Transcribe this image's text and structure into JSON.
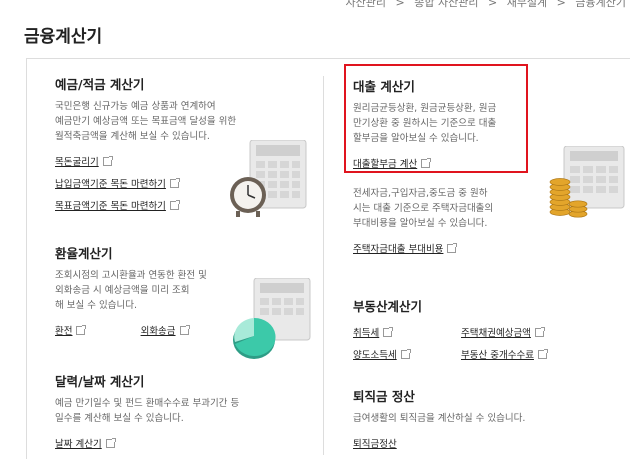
{
  "breadcrumb": [
    "자산관리",
    "종합 자산관리",
    "재무설계",
    "금융계산기"
  ],
  "page_title": "금융계산기",
  "deposit": {
    "title": "예금/적금 계산기",
    "desc": [
      "국민은행 신규가능 예금 상품과 연계하여",
      "예금만기 예상금액 또는 목표금액 달성을 위한",
      "월적축금액을 계산해 보실 수 있습니다."
    ],
    "links": [
      "목돈굴리기",
      "납입금액기준 목돈 마련하기",
      "목표금액기준 목돈 마련하기"
    ]
  },
  "loan": {
    "title": "대출 계산기",
    "desc": [
      "원리금균등상환, 원금균등상환, 원금",
      "만기상환 중 원하시는 기준으로 대출",
      "할부금을 알아보실 수 있습니다."
    ],
    "links": [
      "대출할부금 계산"
    ]
  },
  "housing": {
    "desc": [
      "전세자금,구입자금,중도금 중 원하",
      "시는 대출 기준으로 주택자금대출의",
      "부대비용을 알아보실 수 있습니다."
    ],
    "links": [
      "주택자금대출 부대비용"
    ]
  },
  "exchange": {
    "title": "환율계산기",
    "desc": [
      "조회시점의 고시환율과 연동한 환전 및",
      "외화송금 시 예상금액을 미리 조회",
      "해 보실 수 있습니다."
    ],
    "links": [
      "환전",
      "외화송금"
    ]
  },
  "realestate": {
    "title": "부동산계산기",
    "links": [
      "취득세",
      "주택채권예상금액",
      "양도소득세",
      "부동산 중개수수료"
    ]
  },
  "calendar": {
    "title": "달력/날짜 계산기",
    "desc": [
      "예금 만기일수 및 펀드 환매수수료 부과기간 등",
      "일수를 계산해 보실 수 있습니다."
    ],
    "links": [
      "날짜 계산기"
    ]
  },
  "severance": {
    "title": "퇴직금 정산",
    "desc": [
      "급여생활의 퇴직금을 계산하실 수 있습니다."
    ],
    "links": [
      "퇴직금정산"
    ]
  },
  "colors": {
    "highlight": "#e0141e",
    "coin": "#e3a52b",
    "pie": "#3cc9a9"
  },
  "icons": [
    "external-link-icon",
    "calculator-icon",
    "clock-icon",
    "coins-icon",
    "pie-chart-icon"
  ]
}
